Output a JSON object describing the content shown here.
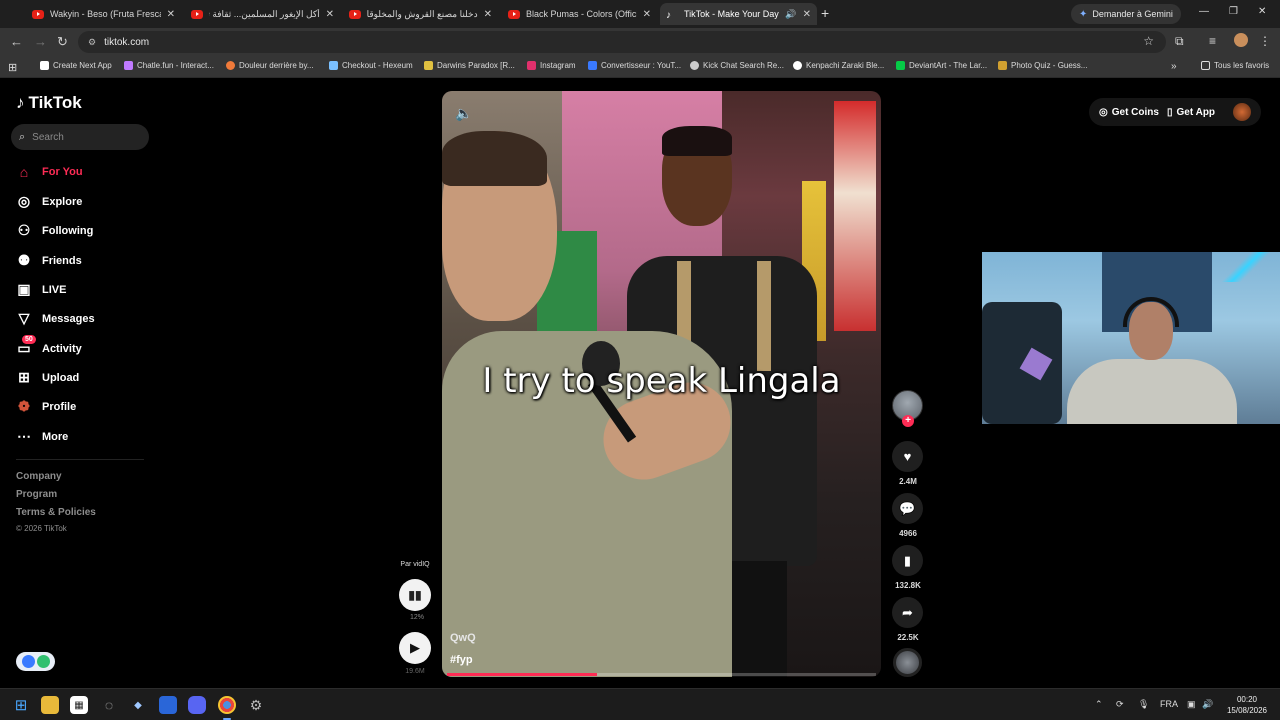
{
  "browser": {
    "tabs": [
      {
        "title": "Wakyin - Beso (Fruta Fresca) [Fr",
        "type": "youtube"
      },
      {
        "title": "أكل الإيغور المسلمين... ثقافة تختلف",
        "type": "youtube"
      },
      {
        "title": "دخلنا مصنع القروش والمخلوقات",
        "type": "youtube"
      },
      {
        "title": "Black Pumas - Colors (Official Li",
        "type": "youtube"
      },
      {
        "title": "TikTok - Make Your Day",
        "type": "tiktok",
        "active": true
      }
    ],
    "new_tab": "+",
    "gemini_button": "Demander à Gemini",
    "url": "tiktok.com",
    "bookmarks": [
      {
        "label": "Create Next App",
        "color": "#ffffff"
      },
      {
        "label": "Chatle.fun - Interact...",
        "color": "#c07aff"
      },
      {
        "label": "Douleur derrière by...",
        "color": "#f07a3a"
      },
      {
        "label": "Checkout - Hexeum",
        "color": "#7ac0ff"
      },
      {
        "label": "Darwins Paradox [R...",
        "color": "#e0c040"
      },
      {
        "label": "Instagram",
        "color": "#e1306c"
      },
      {
        "label": "Convertisseur : YouT...",
        "color": "#3a7aff"
      },
      {
        "label": "Kick Chat Search Re...",
        "color": "#cccccc"
      },
      {
        "label": "Kenpachi Zaraki Ble...",
        "color": "#ffffff"
      },
      {
        "label": "DeviantArt - The Lar...",
        "color": "#05cc47"
      },
      {
        "label": "Photo Quiz - Guess...",
        "color": "#d0a030"
      }
    ],
    "all_bookmarks": "Tous les favoris"
  },
  "tiktok": {
    "logo_text": "TikTok",
    "search_placeholder": "Search",
    "nav": [
      {
        "label": "For You",
        "icon": "home-icon",
        "active": true
      },
      {
        "label": "Explore",
        "icon": "compass-icon"
      },
      {
        "label": "Following",
        "icon": "following-icon"
      },
      {
        "label": "Friends",
        "icon": "friends-icon"
      },
      {
        "label": "LIVE",
        "icon": "live-icon"
      },
      {
        "label": "Messages",
        "icon": "messages-icon"
      },
      {
        "label": "Activity",
        "icon": "activity-icon",
        "badge": "50"
      },
      {
        "label": "Upload",
        "icon": "upload-icon"
      },
      {
        "label": "Profile",
        "icon": "profile-avatar-icon"
      },
      {
        "label": "More",
        "icon": "more-icon"
      }
    ],
    "footer": {
      "company": "Company",
      "program": "Program",
      "terms": "Terms & Policies",
      "copyright": "© 2026 TikTok"
    },
    "top_right": {
      "get_coins": "Get Coins",
      "get_app": "Get App"
    },
    "video": {
      "caption_overlay": "I try to speak Lingala",
      "author": "QwQ",
      "hashtag": "#fyp",
      "progress_fraction": 0.35
    },
    "actions": {
      "likes": "2.4M",
      "comments": "4966",
      "saves": "132.8K",
      "shares": "22.5K"
    },
    "vidiq": {
      "label": "Par vidIQ",
      "percent": "12%",
      "views": "19.6M"
    }
  },
  "taskbar": {
    "language": "FRA",
    "time": "00:20",
    "date": "15/08/2026"
  },
  "colors": {
    "accent": "#fe2c55",
    "background": "#000000"
  }
}
